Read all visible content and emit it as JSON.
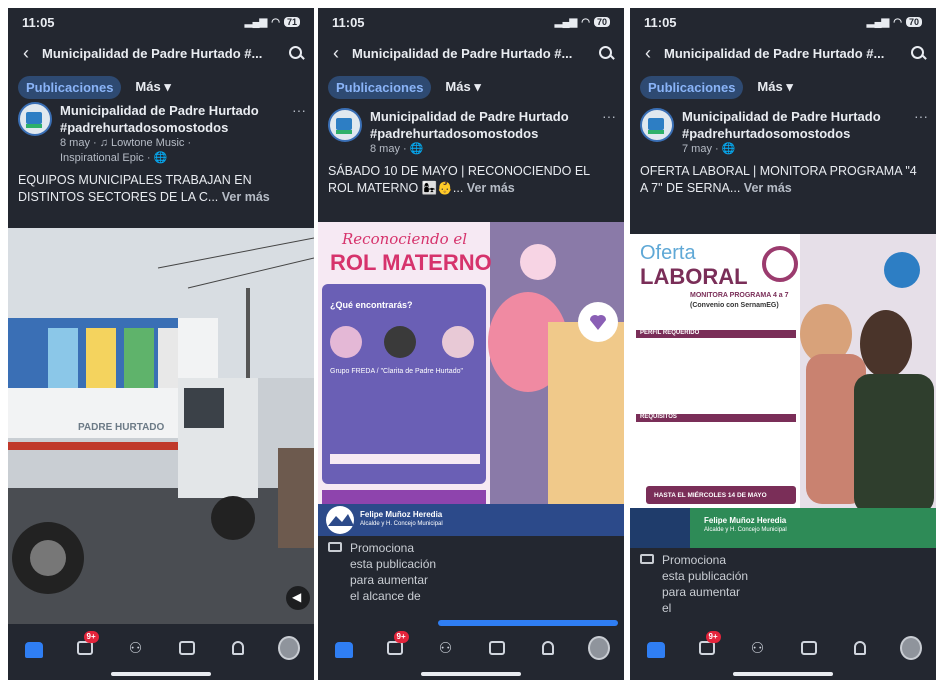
{
  "phones": [
    {
      "status": {
        "time": "11:05",
        "battery": "71"
      },
      "header": {
        "page_name": "Municipalidad de Padre Hurtado #..."
      },
      "tabs": {
        "active": "Publicaciones",
        "more": "Más ▾"
      },
      "post": {
        "author_line1": "Municipalidad de Padre Hurtado",
        "author_line2": "#padrehurtadosomostodos",
        "meta": "8 may · ♫ Lowtone Music ·",
        "meta2": "Inspirational Epic · 🌐",
        "caption": "EQUIPOS MUNICIPALES TRABAJAN EN DISTINTOS SECTORES DE LA C...",
        "see_more": "Ver más",
        "truck_text": "PADRE HURTADO"
      },
      "nav": {
        "badge": "9+"
      }
    },
    {
      "status": {
        "time": "11:05",
        "battery": "70"
      },
      "header": {
        "page_name": "Municipalidad de Padre Hurtado #..."
      },
      "tabs": {
        "active": "Publicaciones",
        "more": "Más ▾"
      },
      "post": {
        "author_line1": "Municipalidad de Padre Hurtado",
        "author_line2": "#padrehurtadosomostodos",
        "meta": "8 may · 🌐",
        "caption": "SÁBADO 10 DE MAYO | RECONOCIENDO EL ROL MATERNO 👩‍👧👶...",
        "see_more": "Ver más",
        "flyer_title1": "Reconociendo el",
        "flyer_title2": "ROL MATERNO",
        "flyer_section": "¿Qué encontrarás?",
        "flyer_group": "Grupo FREDA / \"Clarita de Padre Hurtado\"",
        "flyer_footer_name": "Felipe Muñoz Heredia",
        "flyer_footer_role": "Alcalde y H. Concejo Municipal",
        "promo": "Promociona esta publicación para aumentar el alcance de"
      },
      "nav": {
        "badge": "9+"
      }
    },
    {
      "status": {
        "time": "11:05",
        "battery": "70"
      },
      "header": {
        "page_name": "Municipalidad de Padre Hurtado #..."
      },
      "tabs": {
        "active": "Publicaciones",
        "more": "Más ▾"
      },
      "post": {
        "author_line1": "Municipalidad de Padre Hurtado",
        "author_line2": "#padrehurtadosomostodos",
        "meta": "7 may · 🌐",
        "caption": "OFERTA LABORAL | MONITORA PROGRAMA \"4 A 7\" DE SERNA...",
        "see_more": "Ver más",
        "flyer_title1": "Oferta",
        "flyer_title2": "LABORAL",
        "flyer_sub1": "MONITORA PROGRAMA 4 a 7",
        "flyer_sub2": "(Convenio con SernamEG)",
        "flyer_perfil": "PERFIL REQUERIDO",
        "flyer_req": "REQUISITOS",
        "flyer_deadline": "HASTA EL MIÉRCOLES 14 DE MAYO",
        "flyer_footer_name": "Felipe Muñoz Heredia",
        "flyer_footer_role": "Alcalde y H. Concejo Municipal",
        "promo": "Promociona esta publicación para aumentar el"
      },
      "nav": {
        "badge": "9+"
      }
    }
  ]
}
